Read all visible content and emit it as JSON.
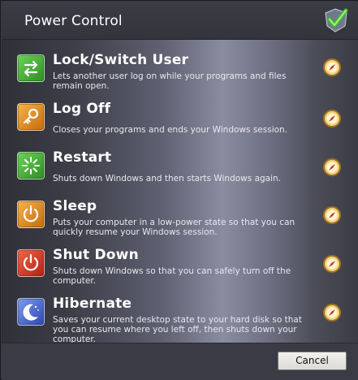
{
  "window": {
    "title": "Power Control",
    "title_icon": "shield-check-icon"
  },
  "items": [
    {
      "label": "Lock/Switch User",
      "desc": "Lets another user log on while your programs and files remain open.",
      "icon": "switch-user-icon",
      "color": "#3fa82f"
    },
    {
      "label": "Log Off",
      "desc": "Closes your programs and ends your Windows session.",
      "icon": "key-icon",
      "color": "#e08a18"
    },
    {
      "label": "Restart",
      "desc": "Shuts down Windows and then starts Windows again.",
      "icon": "restart-icon",
      "color": "#3fa82f"
    },
    {
      "label": "Sleep",
      "desc": "Puts your computer in a low-power state so that you can quickly resume your Windows session.",
      "icon": "power-icon",
      "color": "#e08a18"
    },
    {
      "label": "Shut Down",
      "desc": "Shuts down Windows so that you can safely turn off the computer.",
      "icon": "power-icon",
      "color": "#d8321c"
    },
    {
      "label": "Hibernate",
      "desc": "Saves your current desktop state to your hard disk so that you can resume where you left off, then shuts down your computer.",
      "icon": "moon-icon",
      "color": "#3c59c8"
    }
  ],
  "side_icon": "compass-icon",
  "footer": {
    "cancel_label": "Cancel"
  }
}
